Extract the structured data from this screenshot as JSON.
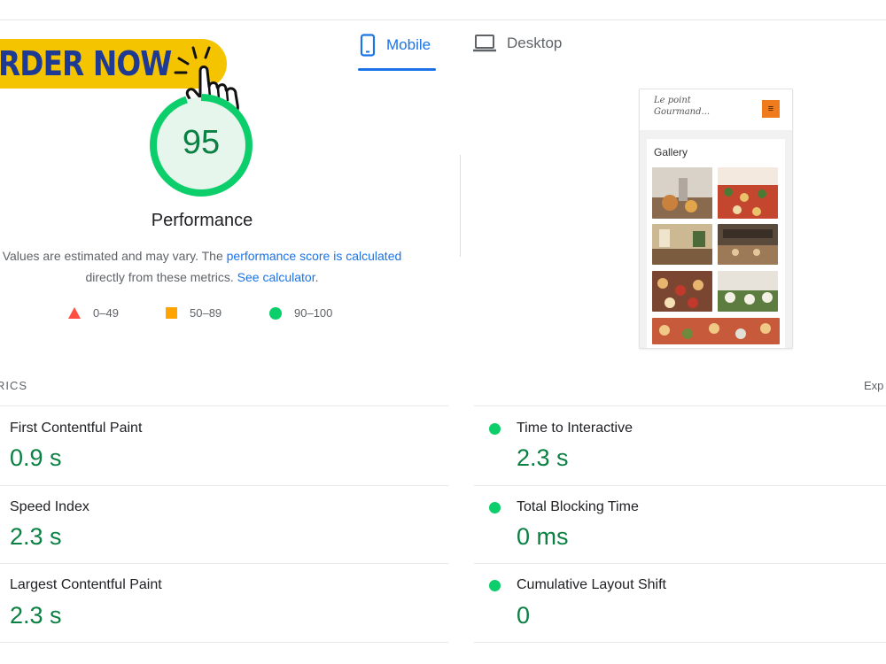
{
  "banner": {
    "order_label": "RDER NOW"
  },
  "tabs": [
    {
      "label": "Mobile",
      "active": true,
      "icon": "phone-icon"
    },
    {
      "label": "Desktop",
      "active": false,
      "icon": "laptop-icon"
    }
  ],
  "performance": {
    "score": "95",
    "score_value": 95,
    "title": "Performance",
    "desc_part1": "Values are estimated and may vary. The ",
    "desc_link1": "performance score is calculated",
    "desc_part2": " directly from these metrics. ",
    "desc_link2": "See calculator",
    "desc_part3": "."
  },
  "legend": [
    {
      "label": "0–49",
      "color": "#ff4e42",
      "shape": "triangle"
    },
    {
      "label": "50–89",
      "color": "#ffa400",
      "shape": "square"
    },
    {
      "label": "90–100",
      "color": "#0cce6b",
      "shape": "circle"
    }
  ],
  "preview": {
    "logo_line1": "Le point",
    "logo_line2": "Gourmand...",
    "gallery_title": "Gallery"
  },
  "metrics": {
    "section_label": "RICS",
    "expand_label": "Exp",
    "left": [
      {
        "name": "First Contentful Paint",
        "value": "0.9 s"
      },
      {
        "name": "Speed Index",
        "value": "2.3 s"
      },
      {
        "name": "Largest Contentful Paint",
        "value": "2.3 s"
      }
    ],
    "right": [
      {
        "name": "Time to Interactive",
        "value": "2.3 s"
      },
      {
        "name": "Total Blocking Time",
        "value": "0 ms"
      },
      {
        "name": "Cumulative Layout Shift",
        "value": "0"
      }
    ]
  },
  "colors": {
    "accent": "#1a73e8",
    "pass": "#0cce6b",
    "pass_text": "#0b8043",
    "banner": "#f5c400",
    "banner_text": "#1f3a93"
  }
}
